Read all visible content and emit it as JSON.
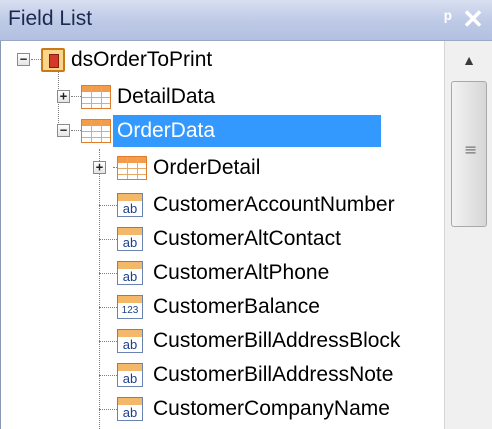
{
  "panel": {
    "title": "Field List",
    "pin_glyph": "ᵖ",
    "close_glyph": "✕"
  },
  "tree": {
    "root": {
      "label": "dsOrderToPrint",
      "expander": "−",
      "icon": "dataset-icon"
    },
    "tables": [
      {
        "label": "DetailData",
        "expander": "+",
        "icon": "table-icon"
      },
      {
        "label": "OrderData",
        "expander": "−",
        "icon": "table-icon",
        "selected": true
      }
    ],
    "child_table": {
      "label": "OrderDetail",
      "expander": "+",
      "icon": "table-icon"
    },
    "fields": [
      {
        "label": "CustomerAccountNumber",
        "type": "ab"
      },
      {
        "label": "CustomerAltContact",
        "type": "ab"
      },
      {
        "label": "CustomerAltPhone",
        "type": "ab"
      },
      {
        "label": "CustomerBalance",
        "type": "123"
      },
      {
        "label": "CustomerBillAddressBlock",
        "type": "ab"
      },
      {
        "label": "CustomerBillAddressNote",
        "type": "ab"
      },
      {
        "label": "CustomerCompanyName",
        "type": "ab"
      }
    ]
  },
  "scroll": {
    "up_glyph": "▲",
    "grip_glyph": "≡"
  },
  "colors": {
    "selection": "#3399ff",
    "title_text": "#1b2a4e"
  }
}
